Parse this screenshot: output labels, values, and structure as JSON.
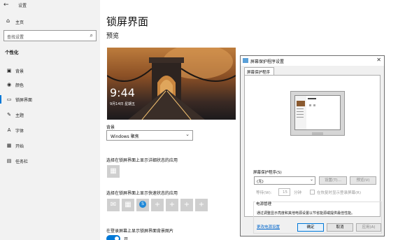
{
  "window": {
    "back_icon": "back-arrow-icon",
    "title": "设置"
  },
  "sidebar": {
    "home_label": "主页",
    "search_placeholder": "查找设置",
    "section_title": "个性化",
    "items": [
      {
        "label": "背景",
        "icon": "image-icon"
      },
      {
        "label": "颜色",
        "icon": "palette-icon"
      },
      {
        "label": "锁屏界面",
        "icon": "lock-screen-icon",
        "active": true
      },
      {
        "label": "主题",
        "icon": "brush-icon"
      },
      {
        "label": "字体",
        "icon": "font-icon"
      },
      {
        "label": "开始",
        "icon": "start-icon"
      },
      {
        "label": "任务栏",
        "icon": "taskbar-icon"
      }
    ]
  },
  "main": {
    "title": "锁屏界面",
    "preview_label": "预览",
    "lock_time": "9:44",
    "lock_date": "9月14日 星期五",
    "background_label": "背景",
    "background_value": "Windows 聚焦",
    "detail_status_label": "选择在锁屏界面上显示详细状态的应用",
    "quick_status_label": "选择在锁屏界面上显示快速状态的应用",
    "signin_bg_label": "在登录屏幕上显示锁屏界面背景图片",
    "signin_bg_state": "开",
    "accent_color": "#0078d7"
  },
  "dialog": {
    "title": "屏幕保护程序设置",
    "tab_label": "屏幕保护程序",
    "screensaver_group_label": "屏幕保护程序(S)",
    "screensaver_value": "(无)",
    "settings_button": "设置(T)...",
    "preview_button": "预览(V)",
    "wait_label": "等待(W):",
    "wait_value": "15",
    "minutes_label": "分钟",
    "resume_checkbox_label": "在恢复时显示登录屏幕(R)",
    "power_group_label": "电源管理",
    "power_description": "通过调整显示亮度和其他电源设置以节省能源或提供最佳性能。",
    "power_link": "更改电源设置",
    "ok_button": "确定",
    "cancel_button": "取消",
    "apply_button": "应用(A)"
  }
}
